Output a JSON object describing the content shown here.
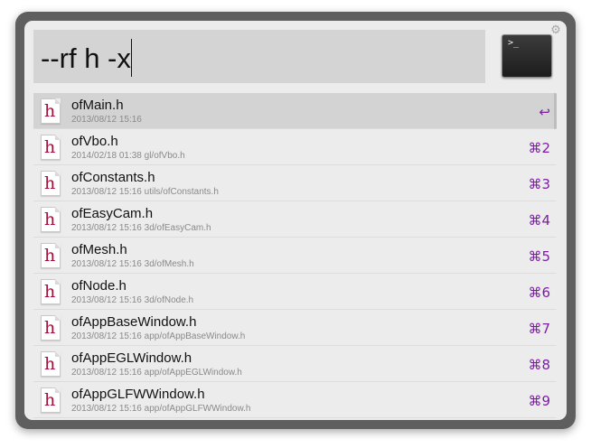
{
  "query": {
    "text": "--rf h -x"
  },
  "results": [
    {
      "title": "ofMain.h",
      "subtitle": "2013/08/12 15:16",
      "shortcut": "↩",
      "icon": "h-file-icon"
    },
    {
      "title": "ofVbo.h",
      "subtitle": "2014/02/18 01:38 gl/ofVbo.h",
      "shortcut": "⌘2",
      "icon": "h-file-icon"
    },
    {
      "title": "ofConstants.h",
      "subtitle": "2013/08/12 15:16 utils/ofConstants.h",
      "shortcut": "⌘3",
      "icon": "h-file-icon"
    },
    {
      "title": "ofEasyCam.h",
      "subtitle": "2013/08/12 15:16 3d/ofEasyCam.h",
      "shortcut": "⌘4",
      "icon": "h-file-icon"
    },
    {
      "title": "ofMesh.h",
      "subtitle": "2013/08/12 15:16 3d/ofMesh.h",
      "shortcut": "⌘5",
      "icon": "h-file-icon"
    },
    {
      "title": "ofNode.h",
      "subtitle": "2013/08/12 15:16 3d/ofNode.h",
      "shortcut": "⌘6",
      "icon": "h-file-icon"
    },
    {
      "title": "ofAppBaseWindow.h",
      "subtitle": "2013/08/12 15:16 app/ofAppBaseWindow.h",
      "shortcut": "⌘7",
      "icon": "h-file-icon"
    },
    {
      "title": "ofAppEGLWindow.h",
      "subtitle": "2013/08/12 15:16 app/ofAppEGLWindow.h",
      "shortcut": "⌘8",
      "icon": "h-file-icon"
    },
    {
      "title": "ofAppGLFWWindow.h",
      "subtitle": "2013/08/12 15:16 app/ofAppGLFWWindow.h",
      "shortcut": "⌘9",
      "icon": "h-file-icon"
    }
  ],
  "icons": {
    "file_letter": "h",
    "terminal_prompt": ">_",
    "gear": "⚙"
  },
  "colors": {
    "shortcut": "#7a1fa0",
    "file_letter": "#a0113a",
    "selected_row": "#d3d3d3"
  }
}
